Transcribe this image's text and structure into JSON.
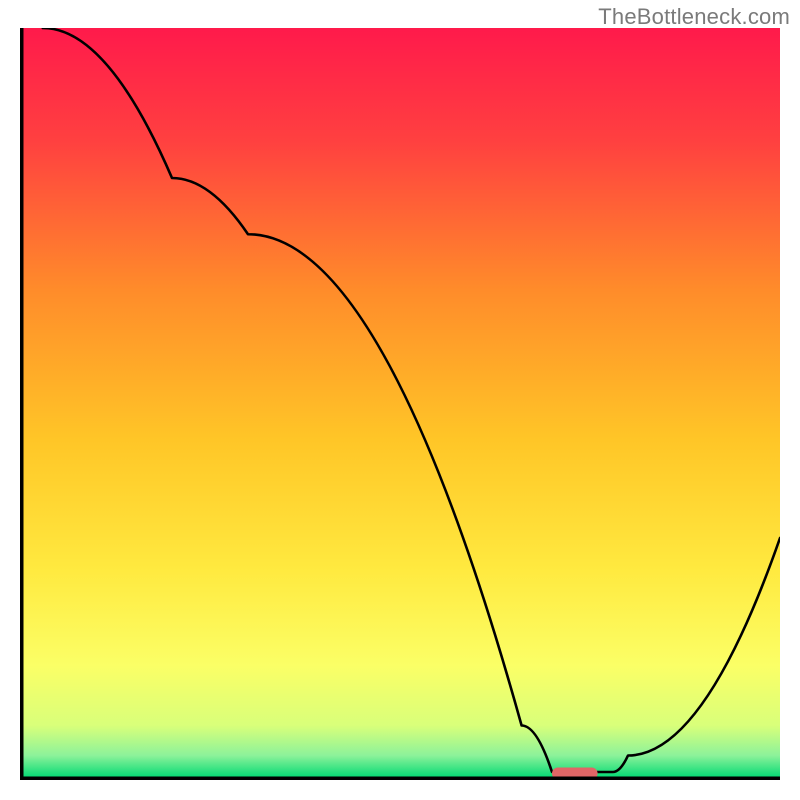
{
  "watermark": "TheBottleneck.com",
  "chart_data": {
    "type": "line",
    "title": "",
    "xlabel": "",
    "ylabel": "",
    "xlim": [
      0,
      100
    ],
    "ylim": [
      0,
      100
    ],
    "background_gradient": {
      "stops": [
        {
          "offset": 0.0,
          "color": "#ff1a4b"
        },
        {
          "offset": 0.15,
          "color": "#ff4040"
        },
        {
          "offset": 0.35,
          "color": "#ff8c2a"
        },
        {
          "offset": 0.55,
          "color": "#ffc627"
        },
        {
          "offset": 0.72,
          "color": "#ffe93f"
        },
        {
          "offset": 0.85,
          "color": "#fbff66"
        },
        {
          "offset": 0.93,
          "color": "#d9ff7a"
        },
        {
          "offset": 0.97,
          "color": "#8cf29a"
        },
        {
          "offset": 1.0,
          "color": "#00d973"
        }
      ]
    },
    "curve": {
      "x": [
        3,
        20,
        30,
        66,
        70,
        78,
        80,
        100
      ],
      "y": [
        100,
        80,
        72.5,
        7,
        0.8,
        0.8,
        3,
        32
      ],
      "note": "y is % height from bottom; visual curve: steep drop-left, flat valley at ~x=66..78, rising right"
    },
    "marker": {
      "x_center": 73,
      "width_pct": 6,
      "y": 0.6,
      "color": "#e06666",
      "shape": "rounded-bar"
    },
    "axes": {
      "show_ticks": false,
      "show_grid": false,
      "frame": {
        "left": true,
        "bottom": true,
        "right": false,
        "top": false,
        "stroke_width": 3.5,
        "color": "#000000"
      }
    }
  }
}
